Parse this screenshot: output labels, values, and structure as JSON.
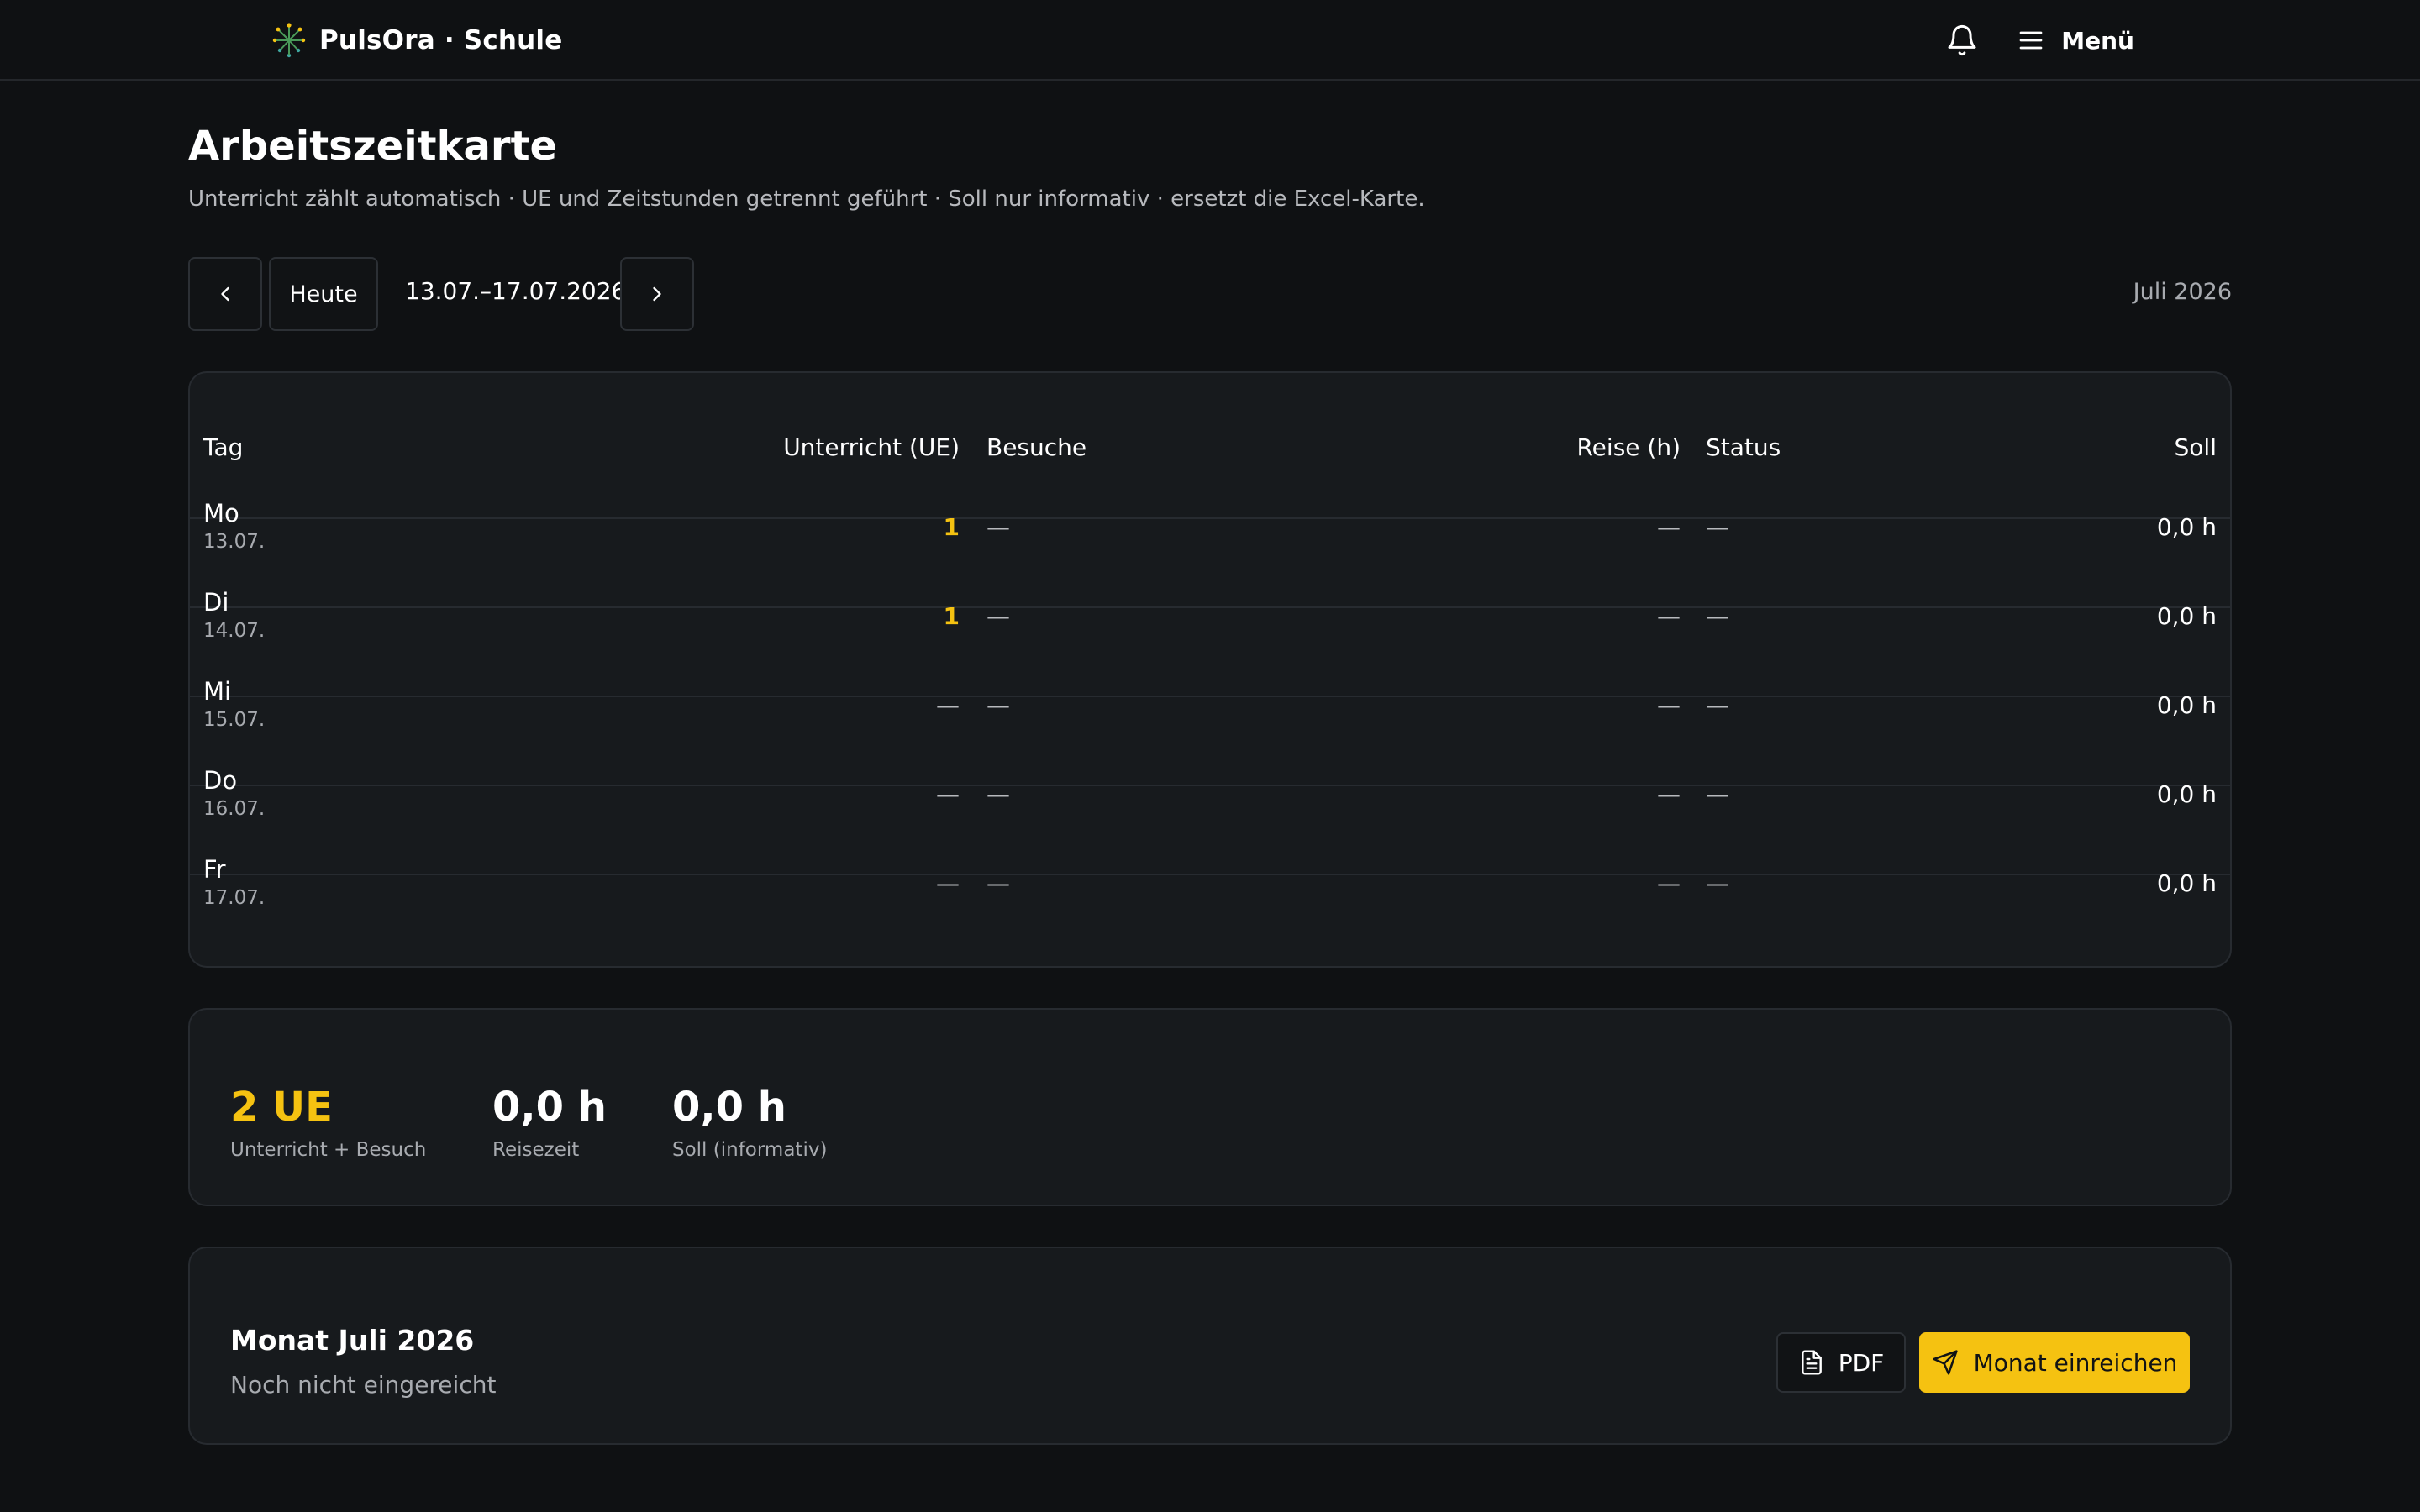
{
  "app": {
    "name": "PulsOra · Schule"
  },
  "header": {
    "menu_label": "Menü"
  },
  "page": {
    "title": "Arbeitszeitkarte",
    "subtitle": "Unterricht zählt automatisch · UE und Zeitstunden getrennt geführt · Soll nur informativ · ersetzt die Excel-Karte."
  },
  "week_nav": {
    "today_label": "Heute",
    "range": "13.07.–17.07.2026",
    "month": "Juli 2026"
  },
  "table": {
    "columns": [
      "Tag",
      "Unterricht (UE)",
      "Besuche",
      "Reise (h)",
      "Status",
      "Soll"
    ],
    "rows": [
      {
        "day": "Mo",
        "date": "13.07.",
        "unterricht": "1",
        "besuche": "—",
        "reise": "—",
        "status": "—",
        "soll": "0,0 h"
      },
      {
        "day": "Di",
        "date": "14.07.",
        "unterricht": "1",
        "besuche": "—",
        "reise": "—",
        "status": "—",
        "soll": "0,0 h"
      },
      {
        "day": "Mi",
        "date": "15.07.",
        "unterricht": "—",
        "besuche": "—",
        "reise": "—",
        "status": "—",
        "soll": "0,0 h"
      },
      {
        "day": "Do",
        "date": "16.07.",
        "unterricht": "—",
        "besuche": "—",
        "reise": "—",
        "status": "—",
        "soll": "0,0 h"
      },
      {
        "day": "Fr",
        "date": "17.07.",
        "unterricht": "—",
        "besuche": "—",
        "reise": "—",
        "status": "—",
        "soll": "0,0 h"
      }
    ]
  },
  "summary": [
    {
      "value": "2 UE",
      "label": "Unterricht + Besuch"
    },
    {
      "value": "0,0 h",
      "label": "Reisezeit"
    },
    {
      "value": "0,0 h",
      "label": "Soll (informativ)"
    }
  ],
  "month_card": {
    "title": "Monat Juli 2026",
    "status": "Noch nicht eingereicht",
    "pdf_label": "PDF",
    "submit_label": "Monat einreichen"
  },
  "colors": {
    "accent": "#f5c211",
    "background": "#0f1113",
    "card": "#171a1d"
  },
  "icons": [
    "logo-icon",
    "bell-icon",
    "menu-icon",
    "chevron-left-icon",
    "chevron-right-icon",
    "document-icon",
    "send-icon"
  ]
}
